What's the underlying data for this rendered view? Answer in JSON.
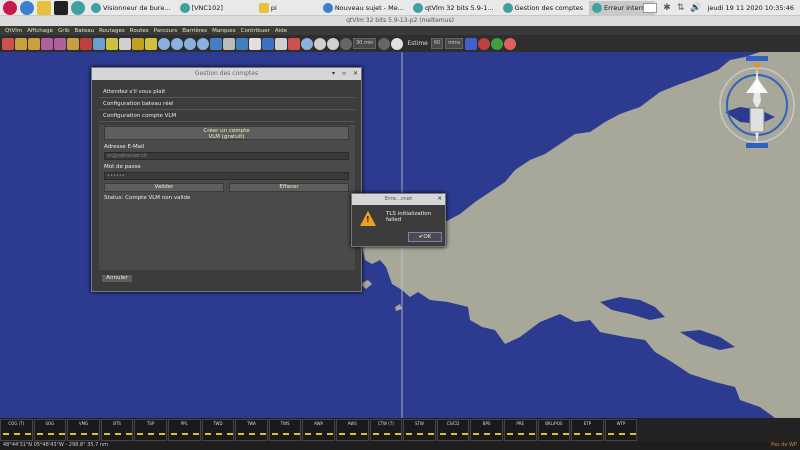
{
  "taskbar": {
    "items": [
      {
        "label": "Visionneur de bure...",
        "active": false
      },
      {
        "label": "[VNC102]",
        "active": false
      },
      {
        "label": "pi",
        "active": false
      },
      {
        "label": "Nouveau sujet - Me...",
        "active": false
      },
      {
        "label": "qtVlm 32 bits 5.9-1...",
        "active": false
      },
      {
        "label": "Gestion des comptes",
        "active": false
      },
      {
        "label": "Erreur internet",
        "active": true
      }
    ],
    "clock": "jeudi 19 11 2020 10:35:46"
  },
  "window_title": "qtVlm 32 bits 5.9-13-p2 (meltemus)",
  "menubar": [
    "QtVlm",
    "Affichage",
    "Grib",
    "Bateau",
    "Routages",
    "Routes",
    "Parcours",
    "Barrières",
    "Marques",
    "Contribuer",
    "Aide"
  ],
  "toolbar": {
    "field_value": "30 min",
    "estime_label": "Estime",
    "estime_value": "60",
    "estime_unit": "mins"
  },
  "dialog": {
    "title": "Gestion des comptes",
    "sections": [
      "Attendez s'il vous plait",
      "Configuration bateau réel",
      "Configuration compte VLM"
    ],
    "create_button": "Créer un compte\nVLM (gratuit)",
    "email_label": "Adresse E-Mail",
    "email_value": "vr@yahouser.ch",
    "password_label": "Mot de passe",
    "password_value": "••••••",
    "validate_button": "Valider",
    "clear_button": "Effacer",
    "status": "Status: Compte VLM non valide",
    "cancel_button": "Annuler"
  },
  "error_dialog": {
    "title": "Erre...rnet",
    "message": "TLS initialization failed",
    "ok_button": "✔OK"
  },
  "bottom_cells": [
    "COG (T)",
    "SOG",
    "VMG",
    "BTS",
    "TSP",
    "PPL",
    "TWD",
    "TWA",
    "TWS",
    "AWA",
    "AWS",
    "CTW (T)",
    "STW",
    "CS/CD",
    "BPS",
    "PRE",
    "BRL/POS",
    "ETP",
    "WTP"
  ],
  "coordinates": "48°44'31\"N 05°48'43\"W - 298.8° 35.7 nm",
  "position_label": "Pas de WP",
  "colors": {
    "sea": "#2c3a90",
    "land": "#a7a79a",
    "accent": "#e8e8b0"
  }
}
